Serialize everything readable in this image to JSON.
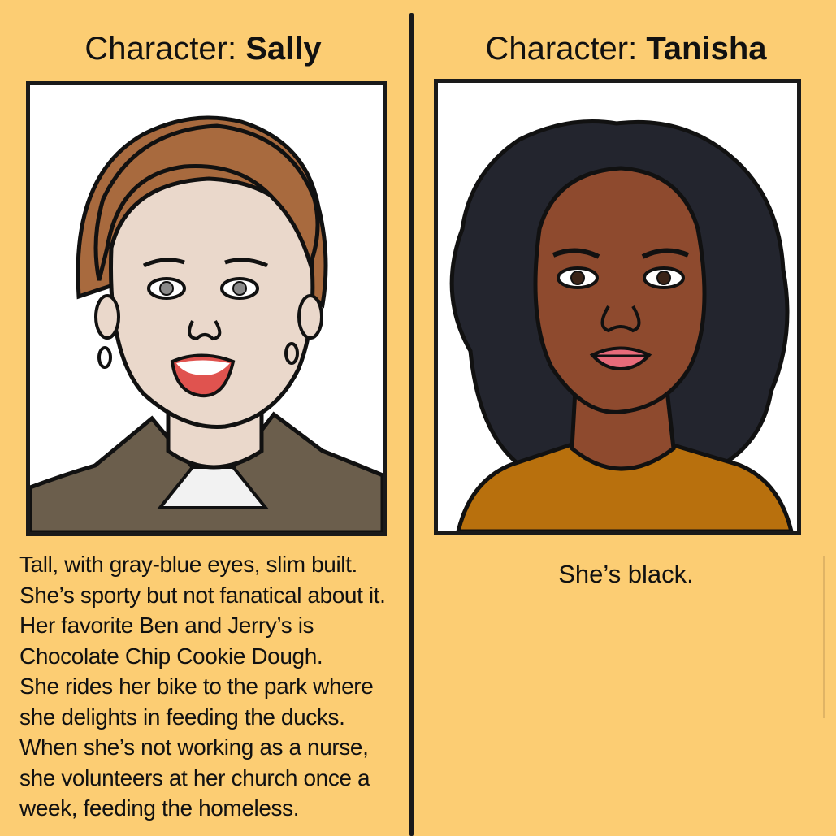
{
  "left": {
    "title_prefix": "Character: ",
    "title_name": "Sally",
    "description": "Tall, with gray-blue eyes, slim built.\nShe’s sporty but not fanatical about it.\nHer favorite Ben and Jerry’s is\nChocolate Chip Cookie Dough.\nShe rides her bike to the park where\nshe delights in feeding the ducks.\nWhen she’s not working as a nurse,\nshe volunteers at her church once a\nweek, feeding the homeless."
  },
  "right": {
    "title_prefix": "Character: ",
    "title_name": "Tanisha",
    "description": "She’s black."
  },
  "colors": {
    "background": "#fccd73",
    "sally_hair": "#a86a3e",
    "sally_skin": "#ead8cb",
    "sally_jacket": "#6b5e4c",
    "tanisha_hair": "#23252e",
    "tanisha_skin": "#8e4a2e",
    "tanisha_shirt": "#b8700d"
  }
}
